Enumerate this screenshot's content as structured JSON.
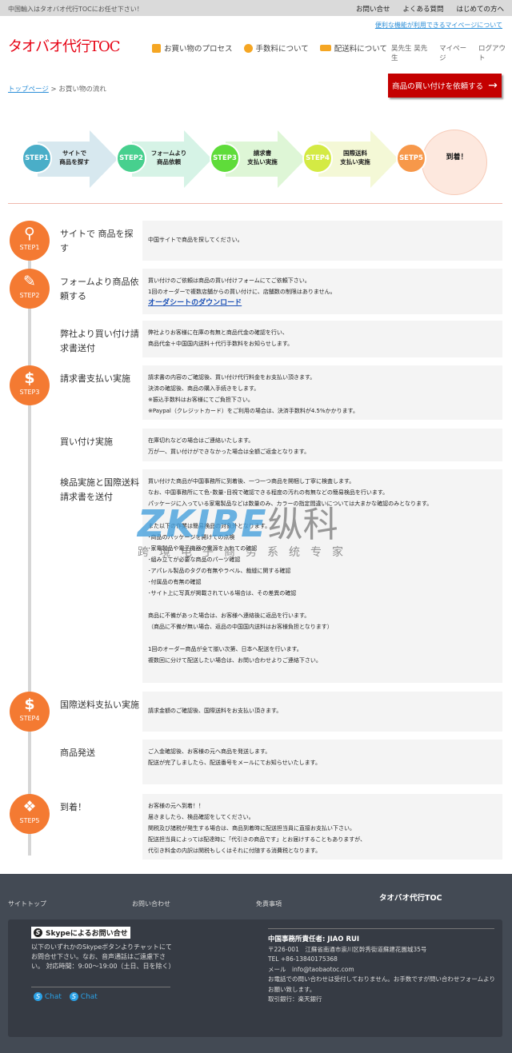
{
  "topbar": {
    "tagline": "中国輸入はタオバオ代行TOCにお任せ下さい！",
    "links": [
      "お問い合せ",
      "よくある質問",
      "はじめての方へ"
    ]
  },
  "header": {
    "mypage_link": "便利な機能が利用できるマイページについて",
    "logo": "タオバオ代行TOC",
    "nav": [
      {
        "label": "お買い物のプロセス",
        "icon": "shopping-bag-icon"
      },
      {
        "label": "手数料について",
        "icon": "fee-icon"
      },
      {
        "label": "配送料について",
        "icon": "truck-icon"
      }
    ],
    "user": [
      "吴先生 吴先生",
      "マイページ",
      "ログアウト"
    ]
  },
  "breadcrumb": {
    "home": "トップページ",
    "sep": ">",
    "current": "お買い物の流れ"
  },
  "request_button": "商品の買い付けを依頼する",
  "banner": [
    {
      "step": "STEP1",
      "label1": "サイトで",
      "label2": "商品を探す",
      "color": "#4aaec8",
      "arrow": "#d7e8ef"
    },
    {
      "step": "STEP2",
      "label1": "フォームより",
      "label2": "商品依頼",
      "color": "#47d08e",
      "arrow": "#d6f3e6"
    },
    {
      "step": "STEP3",
      "label1": "請求書",
      "label2": "支払い実施",
      "color": "#5fdc3a",
      "arrow": "#def6d6"
    },
    {
      "step": "STEP4",
      "label1": "国際送料",
      "label2": "支払い実施",
      "color": "#d4ea44",
      "arrow": "#f4f8d6"
    },
    {
      "step": "SETP5",
      "label1": "到着！",
      "label2": "",
      "color": "#f7984a"
    }
  ],
  "rows": [
    {
      "badge": "STEP1",
      "icon": "search-icon",
      "glyph": "⚲",
      "title": "サイトで 商品を探す",
      "lines": [
        "中国サイトで商品を探してください。"
      ]
    },
    {
      "badge": "STEP2",
      "icon": "pencil-icon",
      "glyph": "✎",
      "title": "フォームより商品依頼する",
      "lines": [
        "買い付けのご依頼は商品の買い付けフォームにてご依頼下さい。",
        "1回のオーダーで複数店舗からの買い付けに、店舗数の制限はありません。"
      ],
      "link": "オーダシートのダウンロード"
    },
    {
      "title": "弊社より買い付け請求書送付",
      "lines": [
        "弊社よりお客様に在庫の有無と商品代金の確認を行い、",
        "商品代金＋中国国内送料＋代行手数料をお知らせします。"
      ]
    },
    {
      "badge": "STEP3",
      "icon": "price-tag-icon",
      "glyph": "$",
      "title": "請求書支払い実施",
      "lines": [
        "請求書の内容のご確認後、買い付け代行料金をお支払い頂きます。",
        "決済の確認後、商品の購入手続きをします。",
        "※振込手数料はお客様にてご負担下さい。",
        "※Paypal（クレジットカード）をご利用の場合は、決済手数料が4.5%かかります。"
      ]
    },
    {
      "title": "買い付け実施",
      "lines": [
        "在庫切れなどの場合はご連絡いたします。",
        "万が一、買い付けができなかった場合は全額ご返金となります。"
      ]
    },
    {
      "title": "検品実施と国際送料請求書を送付",
      "lines": [
        "買い付けた商品が中国事務所に到着後、一つ一つ商品を開梱し丁寧に検査します。",
        "なお、中国事務所にて色･数量･目視で確認できる程度の汚れの有無などの簡易検品を行います。",
        "パッケージに入っている家電製品などは数量のみ、カラーの指定間違いについては大まかな確認のみとなります。",
        "",
        "また以下の作業は簡易検品の対象外となります。",
        "･商品のパッケージを開けての点検",
        "･家電製品や電子機器の電源を入れての確認",
        "･組み立てが必要な商品のパーツ確認",
        "･アパレル製品のタグの有無やラベル、裁縫に関する確認",
        "･付属品の有無の確認",
        "･サイト上に写真が掲載されている場合は、その差異の確認",
        "",
        "商品に不備があった場合は、お客様へ連絡後に返品を行います。",
        "（商品に不備が無い場合、返品の中国国内送料はお客様負担となります）",
        "",
        "1回のオーダー商品が全て揃い次第、日本へ配送を行います。",
        "複数回に分けて配送したい場合は、お問い合わせよりご連絡下さい。"
      ]
    },
    {
      "badge": "STEP4",
      "icon": "price-tag-icon",
      "glyph": "$",
      "title": "国際送料支払い実施",
      "lines": [
        "請求金額のご確認後、国際送料をお支払い頂きます。"
      ]
    },
    {
      "title": "商品発送",
      "lines": [
        "ご入金確認後、お客様の元へ商品を発送します。",
        "配送が完了しましたら、配送番号をメールにてお知らせいたします。"
      ]
    },
    {
      "badge": "STEP5",
      "icon": "open-box-icon",
      "glyph": "❖",
      "title": "到着！",
      "lines": [
        "お客様の元へ到着！！",
        "届きましたら、検品確認をしてください。",
        "関税及び諸税が発生する場合は、商品到着時に配送担当員に直接お支払い下さい。",
        "配送担当員によっては配達時に「代引きの商品です」とお届けすることもありますが、",
        "代引き料金の内訳は関税もしくはそれに付随する消費税となります。"
      ]
    }
  ],
  "watermark": {
    "brand": "ZKIBE",
    "cn": "纵科",
    "tagline": "跨境电子商务系统专家"
  },
  "footer": {
    "links": [
      "サイトトップ",
      "お問い合わせ",
      "免責事項"
    ],
    "brand": "タオバオ代行TOC",
    "skype_title": "Skypeによるお問い合せ",
    "skype_desc": "以下のいずれかのSkypeボタンよりチャットにてお問合せ下さい。なお、音声通話はご遠慮下さい。 対応時間：9:00～19:00（土日、日を除く）",
    "chat": [
      "Chat",
      "Chat"
    ],
    "office_title": "中国事務所責任者: JIAO RUI",
    "office_lines": [
      "〒226-001　江蘇省南通市崇川区幹秀街道蘇建花園城35号",
      "TEL +86-13840175368",
      "メール　info@taobaotoc.com",
      "お電話での問い合わせは受付しておりません。お手数ですが問い合わせフォームよりお願い致します。",
      "取引銀行：楽天銀行"
    ]
  },
  "colors": {
    "accent": "#f47a32",
    "logo": "#e60012",
    "button": "#c40000",
    "footer": "#434a54"
  }
}
